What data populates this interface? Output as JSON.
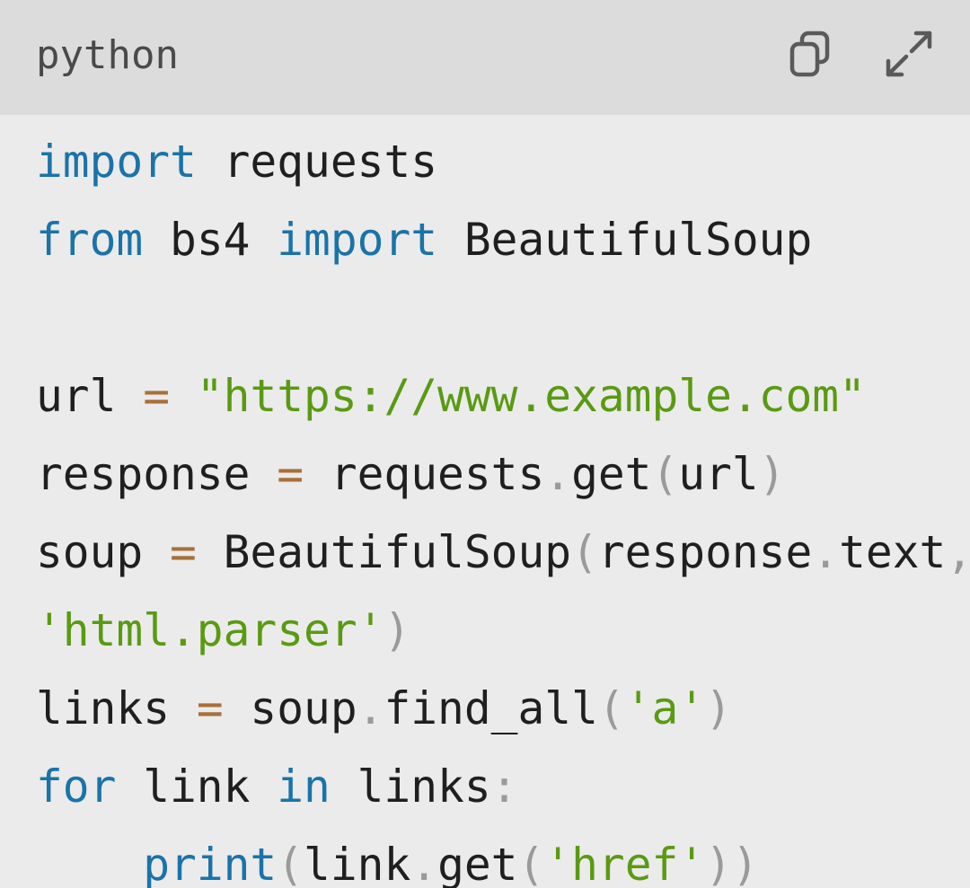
{
  "header": {
    "language": "python",
    "copy_icon": "copy-icon",
    "expand_icon": "expand-icon"
  },
  "colors": {
    "header_bg": "#dcdcdc",
    "code_bg": "#ebebeb",
    "keyword": "#1a73a8",
    "string": "#5a9a12",
    "operator": "#a8703a",
    "punctuation": "#9a9a9a",
    "text": "#1f1f1f"
  },
  "code": {
    "lines": [
      [
        [
          "kw",
          "import"
        ],
        [
          "pl",
          " requests"
        ]
      ],
      [
        [
          "kw",
          "from"
        ],
        [
          "pl",
          " bs4 "
        ],
        [
          "kw",
          "import"
        ],
        [
          "pl",
          " BeautifulSoup"
        ]
      ],
      [],
      [
        [
          "pl",
          "url "
        ],
        [
          "op",
          "="
        ],
        [
          "pl",
          " "
        ],
        [
          "str",
          "\"https://www.example.com\""
        ]
      ],
      [
        [
          "pl",
          "response "
        ],
        [
          "op",
          "="
        ],
        [
          "pl",
          " requests"
        ],
        [
          "pn",
          "."
        ],
        [
          "pl",
          "get"
        ],
        [
          "pn",
          "("
        ],
        [
          "pl",
          "url"
        ],
        [
          "pn",
          ")"
        ]
      ],
      [
        [
          "pl",
          "soup "
        ],
        [
          "op",
          "="
        ],
        [
          "pl",
          " BeautifulSoup"
        ],
        [
          "pn",
          "("
        ],
        [
          "pl",
          "response"
        ],
        [
          "pn",
          "."
        ],
        [
          "pl",
          "text"
        ],
        [
          "pn",
          ","
        ]
      ],
      [
        [
          "str",
          "'html.parser'"
        ],
        [
          "pn",
          ")"
        ]
      ],
      [
        [
          "pl",
          "links "
        ],
        [
          "op",
          "="
        ],
        [
          "pl",
          " soup"
        ],
        [
          "pn",
          "."
        ],
        [
          "pl",
          "find_all"
        ],
        [
          "pn",
          "("
        ],
        [
          "str",
          "'a'"
        ],
        [
          "pn",
          ")"
        ]
      ],
      [
        [
          "kw",
          "for"
        ],
        [
          "pl",
          " link "
        ],
        [
          "kw",
          "in"
        ],
        [
          "pl",
          " links"
        ],
        [
          "pn",
          ":"
        ]
      ],
      [
        [
          "pl",
          "    "
        ],
        [
          "kw",
          "print"
        ],
        [
          "pn",
          "("
        ],
        [
          "pl",
          "link"
        ],
        [
          "pn",
          "."
        ],
        [
          "pl",
          "get"
        ],
        [
          "pn",
          "("
        ],
        [
          "str",
          "'href'"
        ],
        [
          "pn",
          "))"
        ]
      ]
    ]
  }
}
